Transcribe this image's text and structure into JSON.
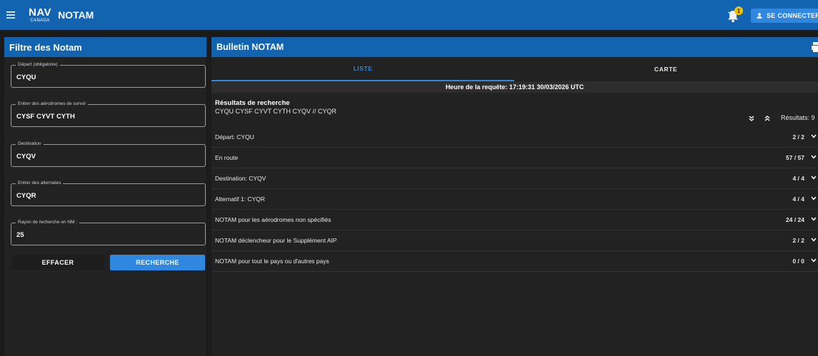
{
  "header": {
    "logo_line1": "NAV",
    "logo_line2": "CANADA",
    "title": "NOTAM",
    "notification_count": "1",
    "login_label": "SE CONNECTER"
  },
  "filter_panel": {
    "title": "Filtre des Notam",
    "fields": [
      {
        "label": "Départ (obligatoire)",
        "value": "CYQU"
      },
      {
        "label": "Entrer des aérodromes de survol",
        "value": "CYSF CYVT CYTH"
      },
      {
        "label": "Destination",
        "value": "CYQV"
      },
      {
        "label": "Entrer des alternates",
        "value": "CYQR"
      },
      {
        "label": "Rayon de recherche en NM :",
        "value": "25"
      }
    ],
    "clear_label": "EFFACER",
    "search_label": "RECHERCHE"
  },
  "bulletin": {
    "title": "Bulletin NOTAM",
    "tabs": [
      {
        "label": "LISTE",
        "active": true
      },
      {
        "label": "CARTE",
        "active": false
      }
    ],
    "query_time": "Heure de la requête: 17:19:31 30/03/2026 UTC",
    "results_title": "Résultats de recherche",
    "results_route": "CYQU CYSF CYVT CYTH CYQV // CYQR",
    "results_count": "Résultats: 9",
    "rows": [
      {
        "label": "Départ: CYQU",
        "count": "2 / 2"
      },
      {
        "label": "En route",
        "count": "57 / 57"
      },
      {
        "label": "Destination: CYQV",
        "count": "4 / 4"
      },
      {
        "label": "Alternatif 1: CYQR",
        "count": "4 / 4"
      },
      {
        "label": "NOTAM pour les aérodromes non spécifiés",
        "count": "24 / 24"
      },
      {
        "label": "NOTAM déclencheur pour le Supplément AIP",
        "count": "2 / 2"
      },
      {
        "label": "NOTAM pour tout le pays ou d'autres pays",
        "count": "0 / 0"
      }
    ]
  },
  "colors": {
    "primary": "#1264b0",
    "accent": "#2f87e0",
    "background": "#1b1b1b",
    "panel": "#222222",
    "badge": "#f2c200"
  }
}
